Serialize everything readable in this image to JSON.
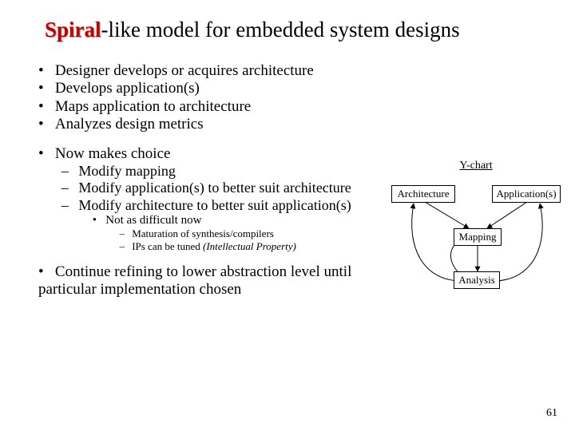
{
  "title": {
    "emph": "Spiral",
    "rest": "-like model for embedded system designs"
  },
  "bullets": {
    "b1": "Designer develops or acquires architecture",
    "b2": "Develops application(s)",
    "b3": "Maps application to architecture",
    "b4": "Analyzes design metrics",
    "b5": "Now makes choice",
    "b5a": "Modify mapping",
    "b5b": "Modify application(s) to better suit architecture",
    "b5c": "Modify architecture to better suit application(s)",
    "b5c1": "Not as difficult now",
    "b5c1a": "Maturation of synthesis/compilers",
    "b5c1b_pre": "IPs can be tuned  ",
    "b5c1b_ip": "(Intellectual Property)",
    "b6": "Continue refining to lower abstraction level until particular implementation chosen"
  },
  "diagram": {
    "label": "Y-chart",
    "arch": "Architecture",
    "apps": "Application(s)",
    "map": "Mapping",
    "anl": "Analysis"
  },
  "page_number": "61"
}
